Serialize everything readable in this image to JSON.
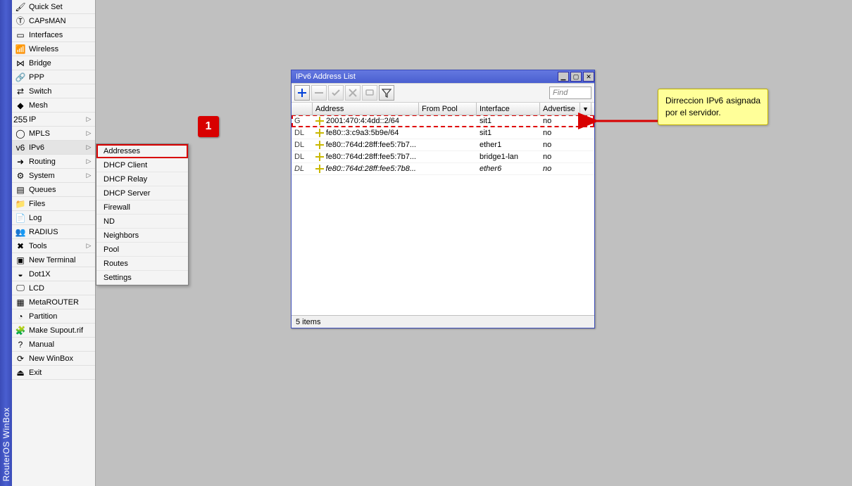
{
  "app_title": "RouterOS WinBox",
  "sidebar": {
    "items": [
      {
        "label": "Quick Set",
        "icon": "🖌",
        "fly": false
      },
      {
        "label": "CAPsMAN",
        "icon": "Ⓣ",
        "fly": false
      },
      {
        "label": "Interfaces",
        "icon": "▭",
        "fly": false
      },
      {
        "label": "Wireless",
        "icon": "📶",
        "fly": false
      },
      {
        "label": "Bridge",
        "icon": "⋈",
        "fly": false
      },
      {
        "label": "PPP",
        "icon": "🔗",
        "fly": false
      },
      {
        "label": "Switch",
        "icon": "⇄",
        "fly": false
      },
      {
        "label": "Mesh",
        "icon": "◆",
        "fly": false
      },
      {
        "label": "IP",
        "icon": "255",
        "fly": true
      },
      {
        "label": "MPLS",
        "icon": "◯",
        "fly": true
      },
      {
        "label": "IPv6",
        "icon": "v6",
        "fly": true,
        "open": true
      },
      {
        "label": "Routing",
        "icon": "➜",
        "fly": true
      },
      {
        "label": "System",
        "icon": "⚙",
        "fly": true
      },
      {
        "label": "Queues",
        "icon": "▤",
        "fly": false
      },
      {
        "label": "Files",
        "icon": "📁",
        "fly": false
      },
      {
        "label": "Log",
        "icon": "📄",
        "fly": false
      },
      {
        "label": "RADIUS",
        "icon": "👥",
        "fly": false
      },
      {
        "label": "Tools",
        "icon": "✖",
        "fly": true
      },
      {
        "label": "New Terminal",
        "icon": "▣",
        "fly": false
      },
      {
        "label": "Dot1X",
        "icon": "◒",
        "fly": false
      },
      {
        "label": "LCD",
        "icon": "🖵",
        "fly": false
      },
      {
        "label": "MetaROUTER",
        "icon": "▦",
        "fly": false
      },
      {
        "label": "Partition",
        "icon": "◔",
        "fly": false
      },
      {
        "label": "Make Supout.rif",
        "icon": "🧩",
        "fly": false
      },
      {
        "label": "Manual",
        "icon": "?",
        "fly": false
      },
      {
        "label": "New WinBox",
        "icon": "⟳",
        "fly": false
      },
      {
        "label": "Exit",
        "icon": "⏏",
        "fly": false
      }
    ]
  },
  "submenu": {
    "items": [
      "Addresses",
      "DHCP Client",
      "DHCP Relay",
      "DHCP Server",
      "Firewall",
      "ND",
      "Neighbors",
      "Pool",
      "Routes",
      "Settings"
    ],
    "selected_index": 0
  },
  "window": {
    "title": "IPv6 Address List",
    "find_placeholder": "Find",
    "columns": [
      "Address",
      "From Pool",
      "Interface",
      "Advertise"
    ],
    "rows": [
      {
        "flags": "G",
        "address": "2001:470:4:4dd::2/64",
        "pool": "",
        "iface": "sit1",
        "adv": "no",
        "hl": true,
        "italic": false
      },
      {
        "flags": "DL",
        "address": "fe80::3:c9a3:5b9e/64",
        "pool": "",
        "iface": "sit1",
        "adv": "no",
        "hl": false,
        "italic": false
      },
      {
        "flags": "DL",
        "address": "fe80::764d:28ff:fee5:7b7...",
        "pool": "",
        "iface": "ether1",
        "adv": "no",
        "hl": false,
        "italic": false
      },
      {
        "flags": "DL",
        "address": "fe80::764d:28ff:fee5:7b7...",
        "pool": "",
        "iface": "bridge1-lan",
        "adv": "no",
        "hl": false,
        "italic": false
      },
      {
        "flags": "DL",
        "address": "fe80::764d:28ff:fee5:7b8...",
        "pool": "",
        "iface": "ether6",
        "adv": "no",
        "hl": false,
        "italic": true
      }
    ],
    "status": "5 items"
  },
  "annotation": {
    "badge": "1",
    "note": "Dirreccion IPv6 asignada por el servidor."
  }
}
